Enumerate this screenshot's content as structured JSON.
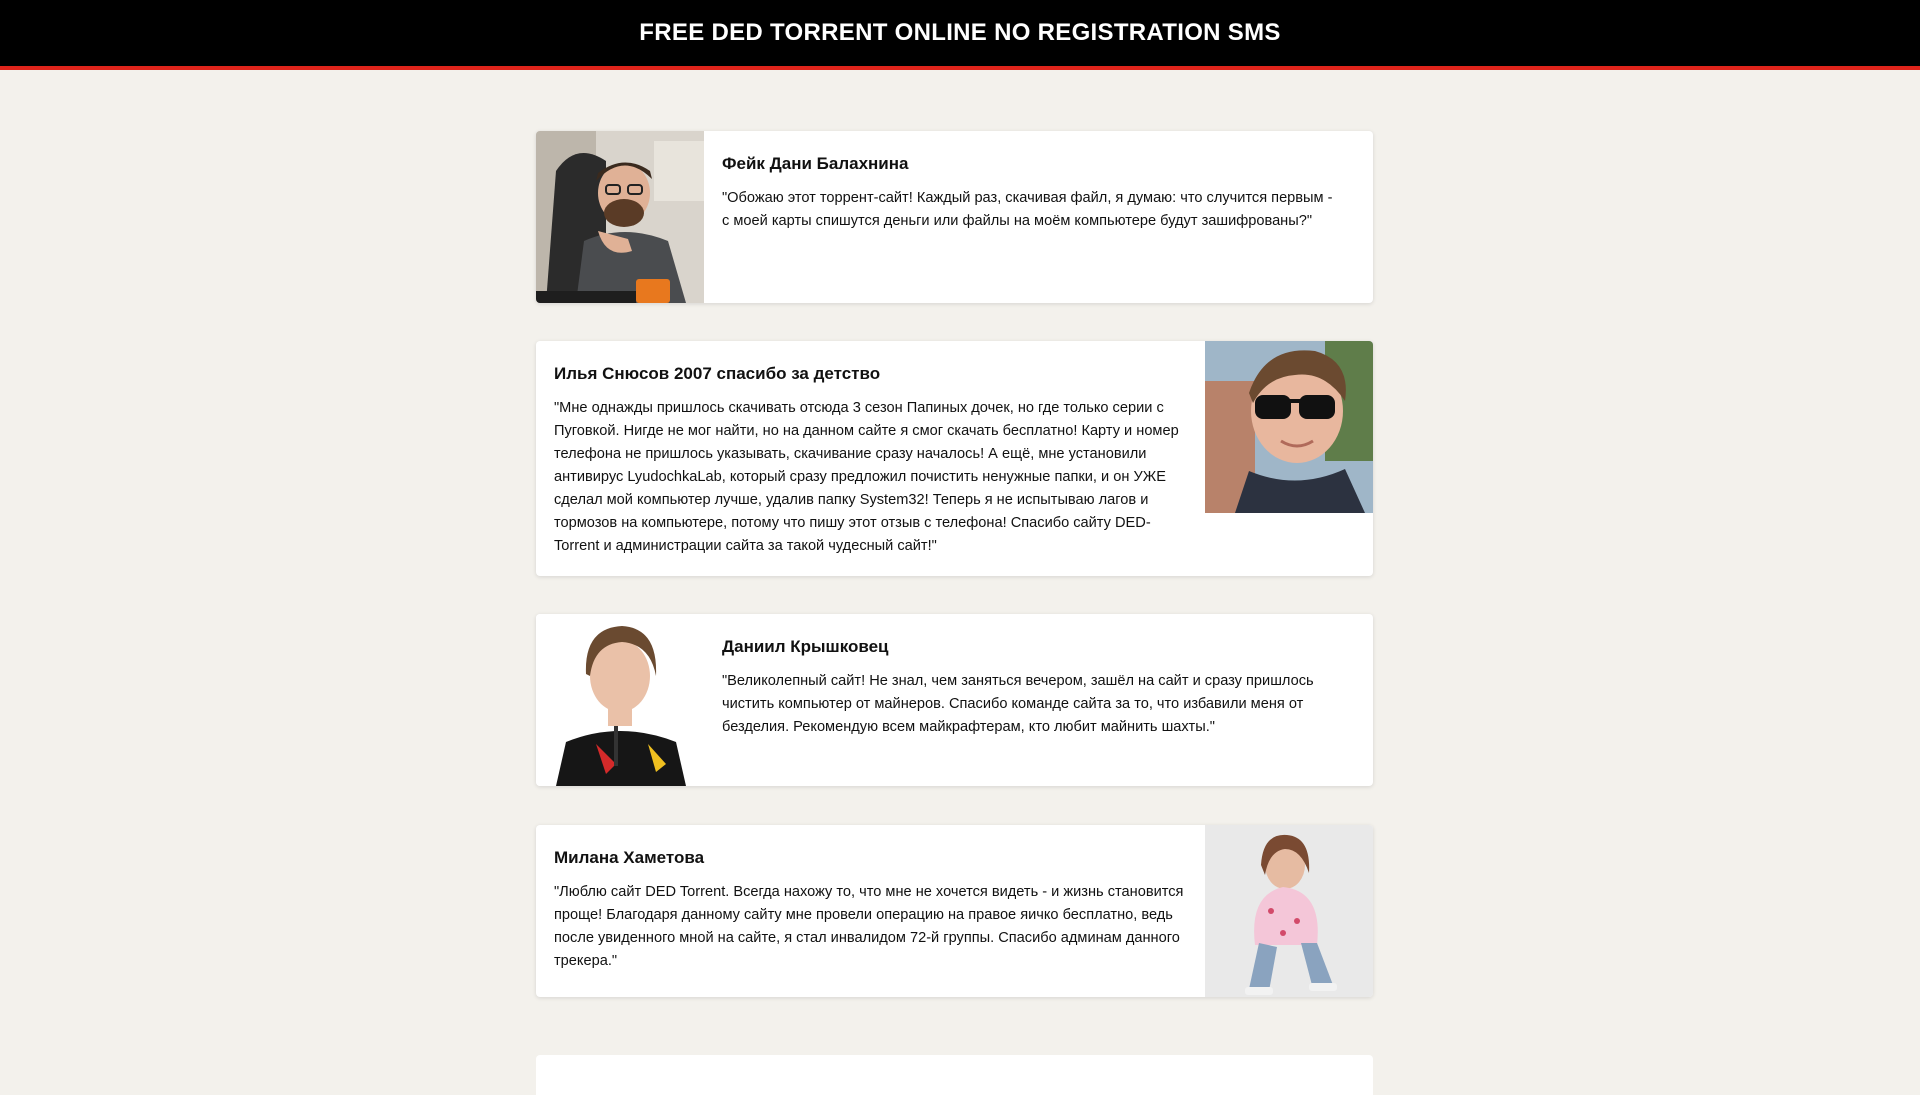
{
  "header": {
    "title": "FREE DED TORRENT ONLINE NO REGISTRATION SMS"
  },
  "colors": {
    "header_bg": "#000000",
    "header_border": "#e0241b",
    "page_bg": "#f3f1ec",
    "card_bg": "#ffffff"
  },
  "reviews": [
    {
      "name": "Фейк Дани Балахнина",
      "quote": "\"Обожаю этот торрент-сайт! Каждый раз, скачивая файл, я думаю: что случится первым - с моей карты спишутся деньги или файлы на моём компьютере будут зашифрованы?\"",
      "photo": "man-with-glasses-photo"
    },
    {
      "name": "Илья Снюсов 2007 спасибо за детство",
      "quote": "\"Мне однажды пришлось скачивать отсюда 3 сезон Папиных дочек, но где только серии с Пуговкой. Нигде не мог найти, но на данном сайте я смог скачать бесплатно! Карту и номер телефона не пришлось указывать, скачивание сразу началось! А ещё, мне установили антивирус LyudochkaLab, который сразу предложил почистить ненужные папки, и он УЖЕ сделал мой компьютер лучше, удалив папку System32! Теперь я не испытываю лагов и тормозов на компьютере, потому что пишу этот отзыв с телефона! Спасибо сайту DED-Torrent и администрации сайта за такой чудесный сайт!\"",
      "photo": "young-man-sunglasses-photo"
    },
    {
      "name": "Даниил Крышковец",
      "quote": "\"Великолепный сайт! Не знал, чем заняться вечером, зашёл на сайт и сразу пришлось чистить компьютер от майнеров. Спасибо команде сайта за то, что избавили меня от безделия. Рекомендую всем майкрафтерам, кто любит майнить шахты.\"",
      "photo": "teen-portrait-photo"
    },
    {
      "name": "Милана Хаметова",
      "quote": "\"Люблю сайт DED Torrent. Всегда нахожу то, что мне не хочется видеть - и жизнь становится проще! Благодаря данному сайту мне провели операцию на правое яичко бесплатно, ведь после увиденного мной на сайте, я стал инвалидом 72-й группы. Спасибо админам данного трекера.\"",
      "photo": "girl-sitting-photo"
    }
  ]
}
